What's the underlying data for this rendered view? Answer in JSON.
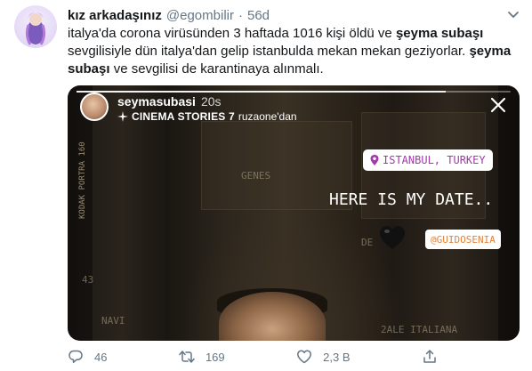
{
  "tweet": {
    "display_name": "kız arkadaşınız",
    "handle": "@egombilir",
    "separator": "·",
    "time": "56d",
    "text": {
      "line1_pre": "italya'da corona virüsünden 3 haftada 1016 kişi öldü ve ",
      "line1_bold": "şeyma subaşı",
      "line2": " sevgilisiyle dün italya'dan gelip istanbulda mekan mekan geziyorlar. ",
      "line2_bold": "şeyma subaşı",
      "line3": " ve sevgilisi de karantinaya alınmalı."
    }
  },
  "story": {
    "username": "seymasubasi",
    "ago": "20s",
    "sub_bold": "CINEMA STORIES 7",
    "sub_rest": "ruzaone'dan",
    "location": "ISTANBUL, TURKEY",
    "caption": "HERE IS MY DATE..",
    "mention": "@GUIDOSENIA",
    "film_edge": "KODAK PORTRA 160",
    "wall_texts": [
      "GENES",
      "DE",
      "NAVI",
      "2ALE ITALIANA",
      "43"
    ],
    "progress": 0.85
  },
  "actions": {
    "replies": "46",
    "retweets": "169",
    "likes": "2,3 B",
    "share": ""
  },
  "icons": {
    "caret": "chevron-down-icon",
    "close": "close-icon",
    "location": "location-pin-icon",
    "heart": "black-heart-emoji",
    "sparkle": "sparkle-icon",
    "reply": "reply-icon",
    "retweet": "retweet-icon",
    "like": "heart-icon",
    "share": "share-icon"
  },
  "colors": {
    "text": "#14171a",
    "muted": "#657786",
    "location_sticker_text": "#a23aa8",
    "mention_text": "#e2833a"
  }
}
